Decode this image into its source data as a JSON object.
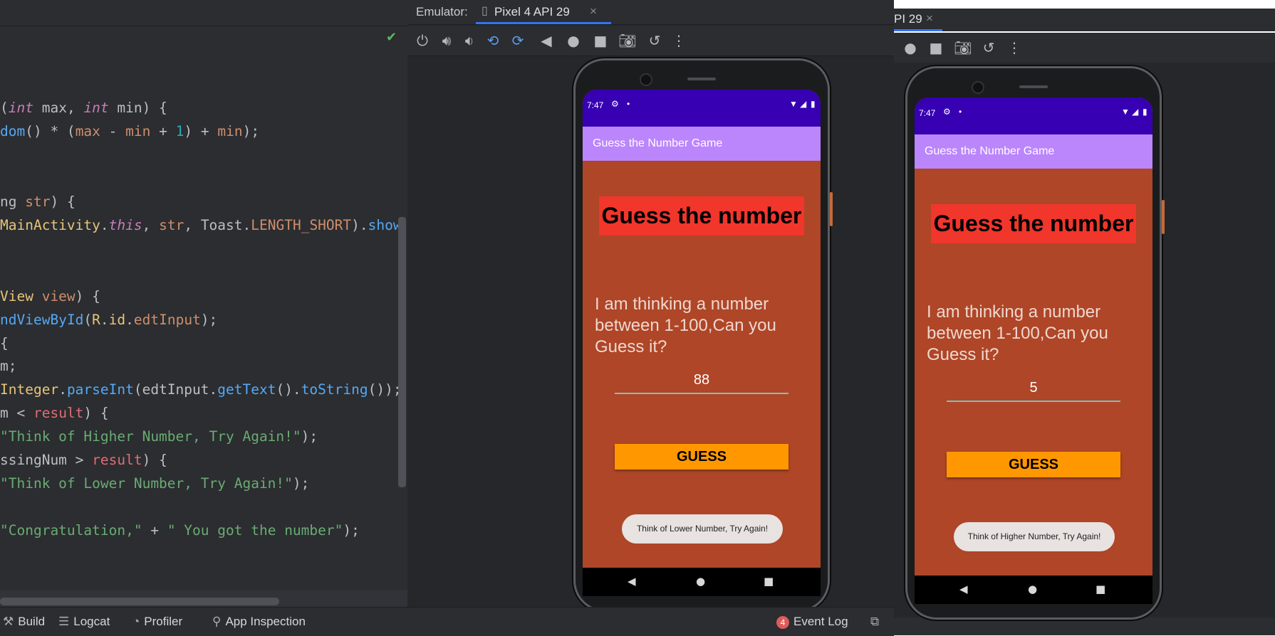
{
  "editor": {
    "lines": [
      {
        "parts": [
          {
            "t": "(",
            "c": ""
          },
          {
            "t": "int",
            "c": "it"
          },
          {
            "t": " max, ",
            "c": ""
          },
          {
            "t": "int",
            "c": "it"
          },
          {
            "t": " min) {",
            "c": ""
          }
        ]
      },
      {
        "parts": [
          {
            "t": "dom",
            "c": "fn"
          },
          {
            "t": "() * (",
            "c": ""
          },
          {
            "t": "max",
            "c": "prm"
          },
          {
            "t": " - ",
            "c": ""
          },
          {
            "t": "min",
            "c": "prm"
          },
          {
            "t": " + ",
            "c": ""
          },
          {
            "t": "1",
            "c": "num"
          },
          {
            "t": ") + ",
            "c": ""
          },
          {
            "t": "min",
            "c": "prm"
          },
          {
            "t": ");",
            "c": ""
          }
        ]
      },
      {
        "parts": [
          {
            "t": "ng ",
            "c": ""
          },
          {
            "t": "str",
            "c": "prm"
          },
          {
            "t": ") {",
            "c": ""
          }
        ]
      },
      {
        "parts": [
          {
            "t": "MainActivity",
            "c": "cls"
          },
          {
            "t": ".",
            "c": ""
          },
          {
            "t": "this",
            "c": "it"
          },
          {
            "t": ", ",
            "c": ""
          },
          {
            "t": "str",
            "c": "prm"
          },
          {
            "t": ", ",
            "c": ""
          },
          {
            "t": "Toast",
            "c": ""
          },
          {
            "t": ".",
            "c": ""
          },
          {
            "t": "LENGTH_SHORT",
            "c": "kw"
          },
          {
            "t": ").",
            "c": ""
          },
          {
            "t": "show",
            "c": "fn"
          }
        ]
      },
      {
        "parts": [
          {
            "t": "View ",
            "c": "cls"
          },
          {
            "t": "view",
            "c": "prm"
          },
          {
            "t": ") {",
            "c": ""
          }
        ]
      },
      {
        "parts": [
          {
            "t": "ndViewById",
            "c": "fn"
          },
          {
            "t": "(",
            "c": ""
          },
          {
            "t": "R",
            "c": "cls"
          },
          {
            "t": ".",
            "c": ""
          },
          {
            "t": "id",
            "c": "cls"
          },
          {
            "t": ".",
            "c": ""
          },
          {
            "t": "edtInput",
            "c": "kw"
          },
          {
            "t": ");",
            "c": ""
          }
        ]
      },
      {
        "parts": [
          {
            "t": "{",
            "c": ""
          }
        ]
      },
      {
        "parts": [
          {
            "t": "m;",
            "c": ""
          }
        ]
      },
      {
        "parts": [
          {
            "t": "Integer",
            "c": "cls"
          },
          {
            "t": ".",
            "c": ""
          },
          {
            "t": "parseInt",
            "c": "fn"
          },
          {
            "t": "(edtInput.",
            "c": ""
          },
          {
            "t": "getText",
            "c": "fn"
          },
          {
            "t": "().",
            "c": ""
          },
          {
            "t": "toString",
            "c": "fn"
          },
          {
            "t": "());",
            "c": ""
          }
        ]
      },
      {
        "parts": [
          {
            "t": "m < ",
            "c": ""
          },
          {
            "t": "result",
            "c": "hl"
          },
          {
            "t": ") {",
            "c": ""
          }
        ]
      },
      {
        "parts": [
          {
            "t": "\"Think of Higher Number, Try Again!\"",
            "c": "str"
          },
          {
            "t": ");",
            "c": ""
          }
        ]
      },
      {
        "parts": [
          {
            "t": "ssingNum > ",
            "c": ""
          },
          {
            "t": "result",
            "c": "hl"
          },
          {
            "t": ") {",
            "c": ""
          }
        ]
      },
      {
        "parts": [
          {
            "t": "\"Think of Lower Number, Try Again!\"",
            "c": "str"
          },
          {
            "t": ");",
            "c": ""
          }
        ]
      },
      {
        "parts": [
          {
            "t": "\"Congratulation,\"",
            "c": "str"
          },
          {
            "t": " + ",
            "c": ""
          },
          {
            "t": "\" You got the number\"",
            "c": "str"
          },
          {
            "t": ");",
            "c": ""
          }
        ]
      }
    ]
  },
  "emulator": {
    "label": "Emulator:",
    "tab_label": "Pixel 4 API 29",
    "close_glyph": "×",
    "toolbar_icons": [
      "power-icon",
      "volume-up-icon",
      "volume-down-icon",
      "rotate-left-icon",
      "rotate-right-icon",
      "back-icon",
      "home-icon",
      "overview-icon",
      "screenshot-icon",
      "snapshot-icon",
      "more-icon"
    ]
  },
  "emulator2": {
    "tab_label": "PI 29",
    "close_glyph": "×"
  },
  "phone1": {
    "time": "7:47",
    "app_title": "Guess the Number Game",
    "headline": "Guess the number",
    "prompt": "I am thinking a number between 1-100,Can you Guess it?",
    "input_value": "88",
    "button_label": "GUESS",
    "toast": "Think of Lower Number, Try Again!"
  },
  "phone2": {
    "time": "7:47",
    "app_title": "Guess the Number Game",
    "headline": "Guess the number",
    "prompt": "I am thinking a number between 1-100,Can you Guess it?",
    "input_value": "5",
    "button_label": "GUESS",
    "toast": "Think of Higher Number, Try Again!"
  },
  "bottombar": {
    "build": "Build",
    "logcat": "Logcat",
    "profiler": "Profiler",
    "app_inspection": "App Inspection",
    "event_log_count": "4",
    "event_log": "Event Log"
  },
  "colors": {
    "accent": "#3574f0",
    "status_bar": "#3700b3",
    "app_bar": "#bb86fc",
    "screen_bg": "#ae4627",
    "headline_bg": "#f1362c",
    "button_bg": "#ff9800"
  }
}
